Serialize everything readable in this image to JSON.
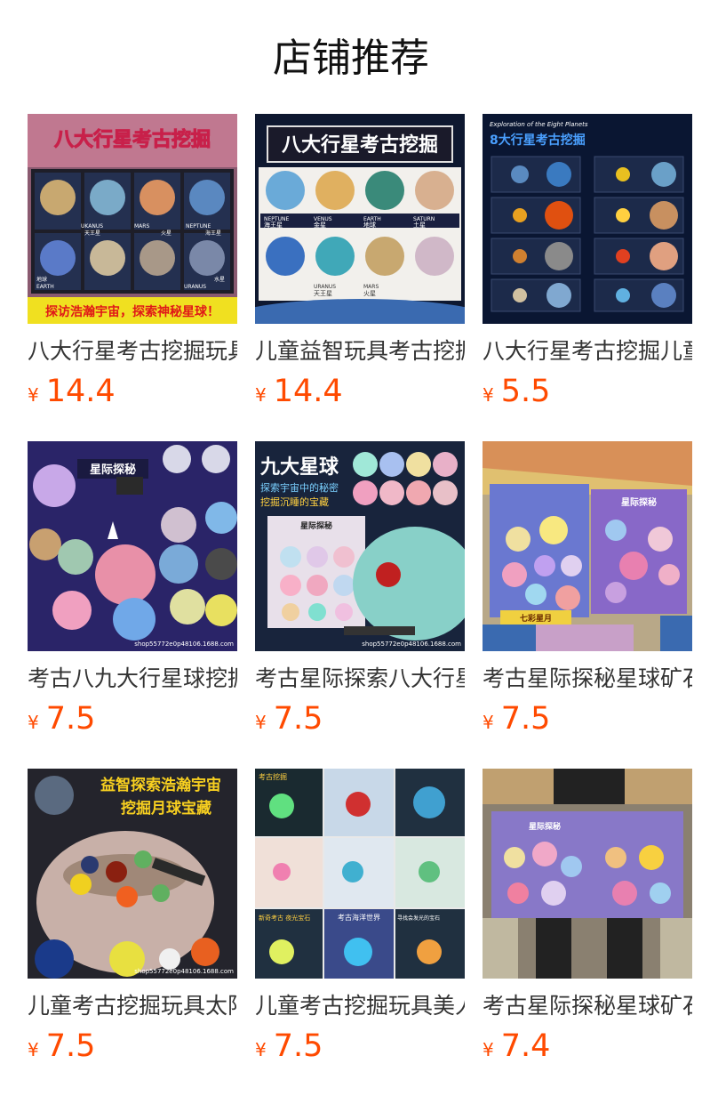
{
  "header": {
    "title": "店铺推荐"
  },
  "currency_symbol": "¥",
  "accent_color": "#ff4a00",
  "products": [
    {
      "title": "八大行星考古挖掘玩具",
      "price": "14.4",
      "image": {
        "icon": "planet-dig-kit-display",
        "bg": "#7a4a6a",
        "banner_text": "八大行星考古挖掘",
        "footer_text": "探访浩瀚宇宙，探索神秘星球！",
        "planet_labels": [
          "UKANUS",
          "天王星",
          "MARS",
          "火星",
          "NEPTUNE",
          "海王星",
          "EARTH",
          "地球",
          "URANUS",
          "水星"
        ]
      }
    },
    {
      "title": "儿童益智玩具考古挖掘",
      "price": "14.4",
      "image": {
        "icon": "planet-dig-kit-boxes",
        "bg": "#142040",
        "banner_text": "八大行星考古挖掘",
        "planet_labels": [
          "NEPTUNE",
          "海王星",
          "VENUS",
          "金星",
          "EARTH",
          "地球",
          "SATURN",
          "土星",
          "URANUS",
          "天王星",
          "MARS",
          "火星"
        ]
      }
    },
    {
      "title": "八大行星考古挖掘儿童",
      "price": "5.5",
      "image": {
        "icon": "planet-grid-eight",
        "bg": "#0b1a3a",
        "top_text": "Exploration of the Eight Planets",
        "banner_text": "8大行星考古挖掘"
      }
    },
    {
      "title": "考古八九大行星球挖掘",
      "price": "7.5",
      "image": {
        "icon": "star-explore-kit",
        "bg": "#2a2060",
        "banner_text": "星际探秘",
        "watermark": "shop55772e0p48106.1688.com"
      }
    },
    {
      "title": "考古星际探索八大行星",
      "price": "7.5",
      "image": {
        "icon": "nine-planets-kit",
        "bg": "#182540",
        "banner_text": "九大星球",
        "sub_text": "探索宇宙中的秘密",
        "sub_text2": "挖掘沉睡的宝藏",
        "box_text": "星际探秘",
        "watermark": "shop55772e0p48106.1688.com"
      }
    },
    {
      "title": "考古星际探秘星球矿石",
      "price": "7.5",
      "image": {
        "icon": "kit-held-by-hands",
        "bg": "#c8b89a",
        "box_text": "星际探秘",
        "box_footer": "七彩星月"
      }
    },
    {
      "title": "儿童考古挖掘玩具太阳",
      "price": "7.5",
      "image": {
        "icon": "moon-treasure-dig",
        "bg": "#2a2a30",
        "banner_text": "益智探索浩瀚宇宙",
        "banner_text2": "挖掘月球宝藏",
        "watermark": "shop55772e0p48106.1688.com"
      }
    },
    {
      "title": "儿童考古挖掘玩具美人",
      "price": "7.5",
      "image": {
        "icon": "gem-dig-collage",
        "bg": "#f0f0f0",
        "labels": [
          "考古挖掘",
          "新奇考古 夜光宝石",
          "考古海洋世界",
          "寻找会发光的宝石"
        ]
      }
    },
    {
      "title": "考古星际探秘星球矿石",
      "price": "7.4",
      "image": {
        "icon": "kit-held-in-store",
        "bg": "#8a8070",
        "box_text": "星际探秘"
      }
    }
  ]
}
